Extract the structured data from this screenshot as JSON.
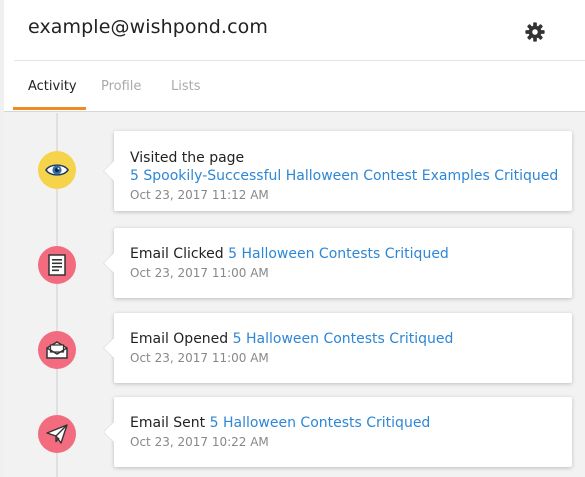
{
  "header": {
    "email": "example@wishpond.com"
  },
  "tabs": [
    {
      "label": "Activity",
      "active": true
    },
    {
      "label": "Profile",
      "active": false
    },
    {
      "label": "Lists",
      "active": false
    }
  ],
  "colors": {
    "accent": "#f08a24",
    "link": "#2d86d6",
    "visited_icon_bg": "#f5d34a",
    "email_icon_bg": "#f26b7f"
  },
  "events": [
    {
      "icon": "eye-icon",
      "label": "Visited the page",
      "link": "5 Spookily-Successful Halloween Contest Examples Critiqued",
      "time": "Oct 23, 2017 11:12 AM"
    },
    {
      "icon": "document-icon",
      "label": "Email Clicked",
      "link": "5 Halloween Contests Critiqued",
      "time": "Oct 23, 2017 11:00 AM"
    },
    {
      "icon": "envelope-open-icon",
      "label": "Email Opened",
      "link": "5 Halloween Contests Critiqued",
      "time": "Oct 23, 2017 11:00 AM"
    },
    {
      "icon": "paper-plane-icon",
      "label": "Email Sent",
      "link": "5 Halloween Contests Critiqued",
      "time": "Oct 23, 2017 10:22 AM"
    }
  ]
}
